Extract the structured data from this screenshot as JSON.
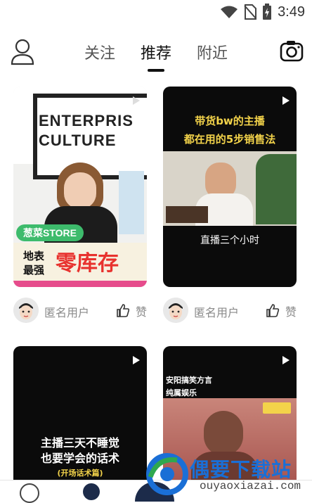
{
  "status_bar": {
    "time": "3:49"
  },
  "nav": {
    "tabs": [
      {
        "label": "关注"
      },
      {
        "label": "推荐"
      },
      {
        "label": "附近"
      }
    ],
    "active_tab": "推荐"
  },
  "feed": [
    {
      "thumb_texts": [
        "ENTERPRIS",
        "CULTURE",
        "葱菜STORE",
        "地表",
        "最强",
        "零库存"
      ],
      "user": "匿名用户",
      "like_label": "赞"
    },
    {
      "thumb_texts": [
        "带货bw的主播",
        "都在用的5步销售法",
        "直播三个小时"
      ],
      "user": "匿名用户",
      "like_label": "赞"
    },
    {
      "thumb_texts": [
        "主播三天不睡觉",
        "也要学会的话术",
        "(开场话术篇)"
      ],
      "user": "",
      "like_label": ""
    },
    {
      "thumb_texts": [
        "安阳搞笑方言",
        "纯属娱乐"
      ],
      "user": "",
      "like_label": ""
    }
  ],
  "watermark": {
    "title": "偶要下载站",
    "url": "ouyaoxiazai.com"
  },
  "colors": {
    "accent": "#1a6fd6",
    "muted": "#8a8a8a",
    "red_text": "#e8322e",
    "green_tag": "#3dbb6c"
  }
}
